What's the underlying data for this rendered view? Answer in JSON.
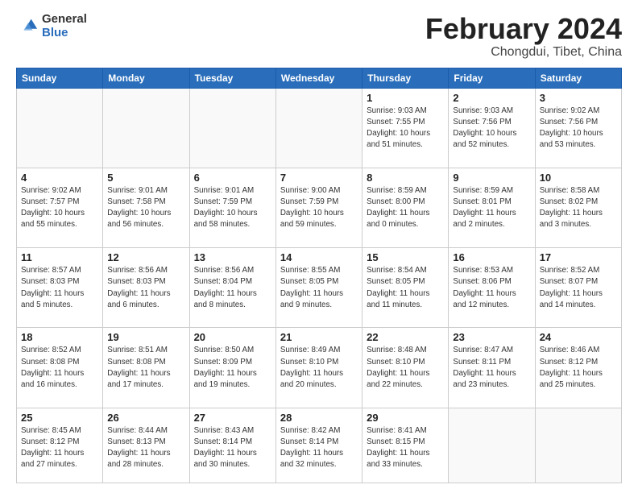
{
  "logo": {
    "general": "General",
    "blue": "Blue"
  },
  "title": {
    "month": "February 2024",
    "location": "Chongdui, Tibet, China"
  },
  "weekdays": [
    "Sunday",
    "Monday",
    "Tuesday",
    "Wednesday",
    "Thursday",
    "Friday",
    "Saturday"
  ],
  "weeks": [
    [
      {
        "day": "",
        "info": ""
      },
      {
        "day": "",
        "info": ""
      },
      {
        "day": "",
        "info": ""
      },
      {
        "day": "",
        "info": ""
      },
      {
        "day": "1",
        "info": "Sunrise: 9:03 AM\nSunset: 7:55 PM\nDaylight: 10 hours\nand 51 minutes."
      },
      {
        "day": "2",
        "info": "Sunrise: 9:03 AM\nSunset: 7:56 PM\nDaylight: 10 hours\nand 52 minutes."
      },
      {
        "day": "3",
        "info": "Sunrise: 9:02 AM\nSunset: 7:56 PM\nDaylight: 10 hours\nand 53 minutes."
      }
    ],
    [
      {
        "day": "4",
        "info": "Sunrise: 9:02 AM\nSunset: 7:57 PM\nDaylight: 10 hours\nand 55 minutes."
      },
      {
        "day": "5",
        "info": "Sunrise: 9:01 AM\nSunset: 7:58 PM\nDaylight: 10 hours\nand 56 minutes."
      },
      {
        "day": "6",
        "info": "Sunrise: 9:01 AM\nSunset: 7:59 PM\nDaylight: 10 hours\nand 58 minutes."
      },
      {
        "day": "7",
        "info": "Sunrise: 9:00 AM\nSunset: 7:59 PM\nDaylight: 10 hours\nand 59 minutes."
      },
      {
        "day": "8",
        "info": "Sunrise: 8:59 AM\nSunset: 8:00 PM\nDaylight: 11 hours\nand 0 minutes."
      },
      {
        "day": "9",
        "info": "Sunrise: 8:59 AM\nSunset: 8:01 PM\nDaylight: 11 hours\nand 2 minutes."
      },
      {
        "day": "10",
        "info": "Sunrise: 8:58 AM\nSunset: 8:02 PM\nDaylight: 11 hours\nand 3 minutes."
      }
    ],
    [
      {
        "day": "11",
        "info": "Sunrise: 8:57 AM\nSunset: 8:03 PM\nDaylight: 11 hours\nand 5 minutes."
      },
      {
        "day": "12",
        "info": "Sunrise: 8:56 AM\nSunset: 8:03 PM\nDaylight: 11 hours\nand 6 minutes."
      },
      {
        "day": "13",
        "info": "Sunrise: 8:56 AM\nSunset: 8:04 PM\nDaylight: 11 hours\nand 8 minutes."
      },
      {
        "day": "14",
        "info": "Sunrise: 8:55 AM\nSunset: 8:05 PM\nDaylight: 11 hours\nand 9 minutes."
      },
      {
        "day": "15",
        "info": "Sunrise: 8:54 AM\nSunset: 8:05 PM\nDaylight: 11 hours\nand 11 minutes."
      },
      {
        "day": "16",
        "info": "Sunrise: 8:53 AM\nSunset: 8:06 PM\nDaylight: 11 hours\nand 12 minutes."
      },
      {
        "day": "17",
        "info": "Sunrise: 8:52 AM\nSunset: 8:07 PM\nDaylight: 11 hours\nand 14 minutes."
      }
    ],
    [
      {
        "day": "18",
        "info": "Sunrise: 8:52 AM\nSunset: 8:08 PM\nDaylight: 11 hours\nand 16 minutes."
      },
      {
        "day": "19",
        "info": "Sunrise: 8:51 AM\nSunset: 8:08 PM\nDaylight: 11 hours\nand 17 minutes."
      },
      {
        "day": "20",
        "info": "Sunrise: 8:50 AM\nSunset: 8:09 PM\nDaylight: 11 hours\nand 19 minutes."
      },
      {
        "day": "21",
        "info": "Sunrise: 8:49 AM\nSunset: 8:10 PM\nDaylight: 11 hours\nand 20 minutes."
      },
      {
        "day": "22",
        "info": "Sunrise: 8:48 AM\nSunset: 8:10 PM\nDaylight: 11 hours\nand 22 minutes."
      },
      {
        "day": "23",
        "info": "Sunrise: 8:47 AM\nSunset: 8:11 PM\nDaylight: 11 hours\nand 23 minutes."
      },
      {
        "day": "24",
        "info": "Sunrise: 8:46 AM\nSunset: 8:12 PM\nDaylight: 11 hours\nand 25 minutes."
      }
    ],
    [
      {
        "day": "25",
        "info": "Sunrise: 8:45 AM\nSunset: 8:12 PM\nDaylight: 11 hours\nand 27 minutes."
      },
      {
        "day": "26",
        "info": "Sunrise: 8:44 AM\nSunset: 8:13 PM\nDaylight: 11 hours\nand 28 minutes."
      },
      {
        "day": "27",
        "info": "Sunrise: 8:43 AM\nSunset: 8:14 PM\nDaylight: 11 hours\nand 30 minutes."
      },
      {
        "day": "28",
        "info": "Sunrise: 8:42 AM\nSunset: 8:14 PM\nDaylight: 11 hours\nand 32 minutes."
      },
      {
        "day": "29",
        "info": "Sunrise: 8:41 AM\nSunset: 8:15 PM\nDaylight: 11 hours\nand 33 minutes."
      },
      {
        "day": "",
        "info": ""
      },
      {
        "day": "",
        "info": ""
      }
    ]
  ]
}
